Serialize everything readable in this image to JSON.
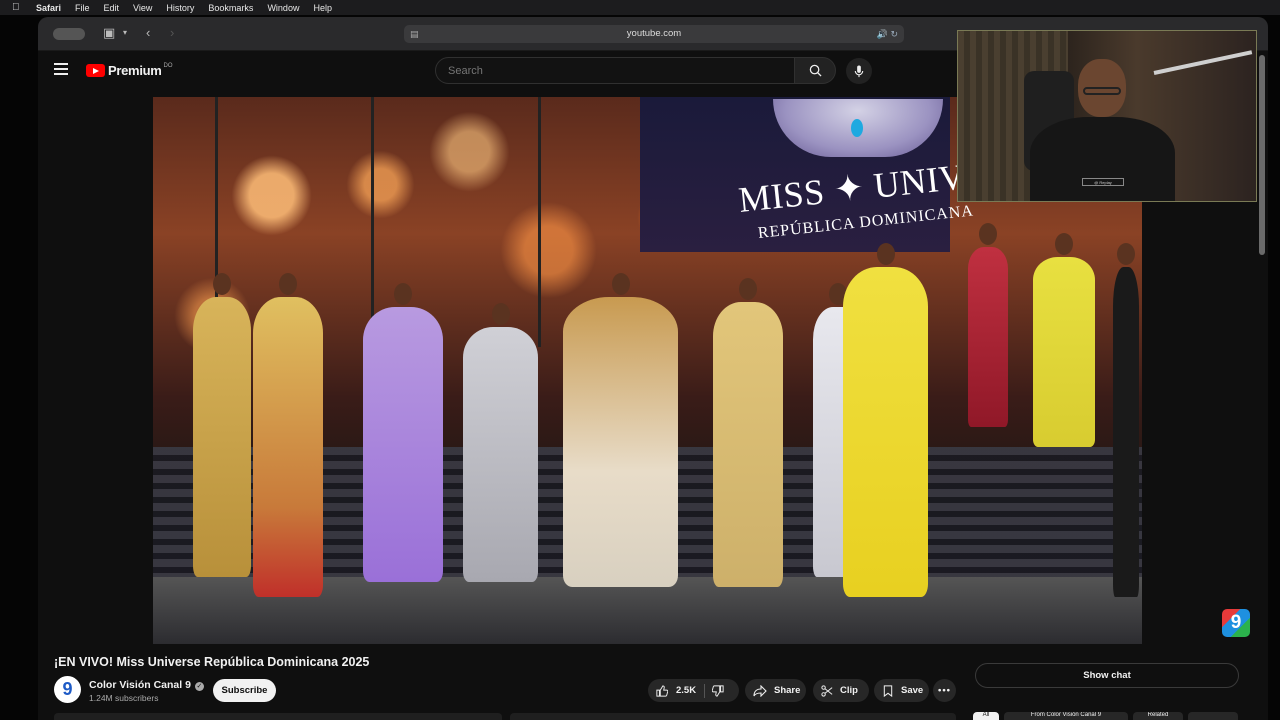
{
  "menubar": {
    "apple": "",
    "app": "Safari",
    "items": [
      "File",
      "Edit",
      "View",
      "History",
      "Bookmarks",
      "Window",
      "Help"
    ]
  },
  "browser": {
    "address": "youtube.com"
  },
  "youtube": {
    "logo_text": "Premium",
    "logo_suffix": "DO",
    "search_placeholder": "Search"
  },
  "video": {
    "banner_line1": "MISS ✦ UNIVERSE",
    "banner_line2": "REPÚBLICA DOMINICANA",
    "channel_bug": "9",
    "title": "¡EN VIVO! Miss Universe República Dominicana 2025"
  },
  "webcam": {
    "badge": "@ Replay"
  },
  "channel": {
    "avatar": "9",
    "name": "Color Visión Canal 9",
    "subscribers": "1.24M subscribers",
    "subscribe_label": "Subscribe"
  },
  "actions": {
    "likes": "2.5K",
    "share": "Share",
    "clip": "Clip",
    "save": "Save"
  },
  "chat": {
    "show_chat": "Show chat"
  },
  "chips": [
    "All",
    "From Color Visión Canal 9",
    "Related"
  ],
  "colors": {
    "accent_red": "#ff0000",
    "background": "#0f0f0f",
    "pill": "#272727"
  }
}
